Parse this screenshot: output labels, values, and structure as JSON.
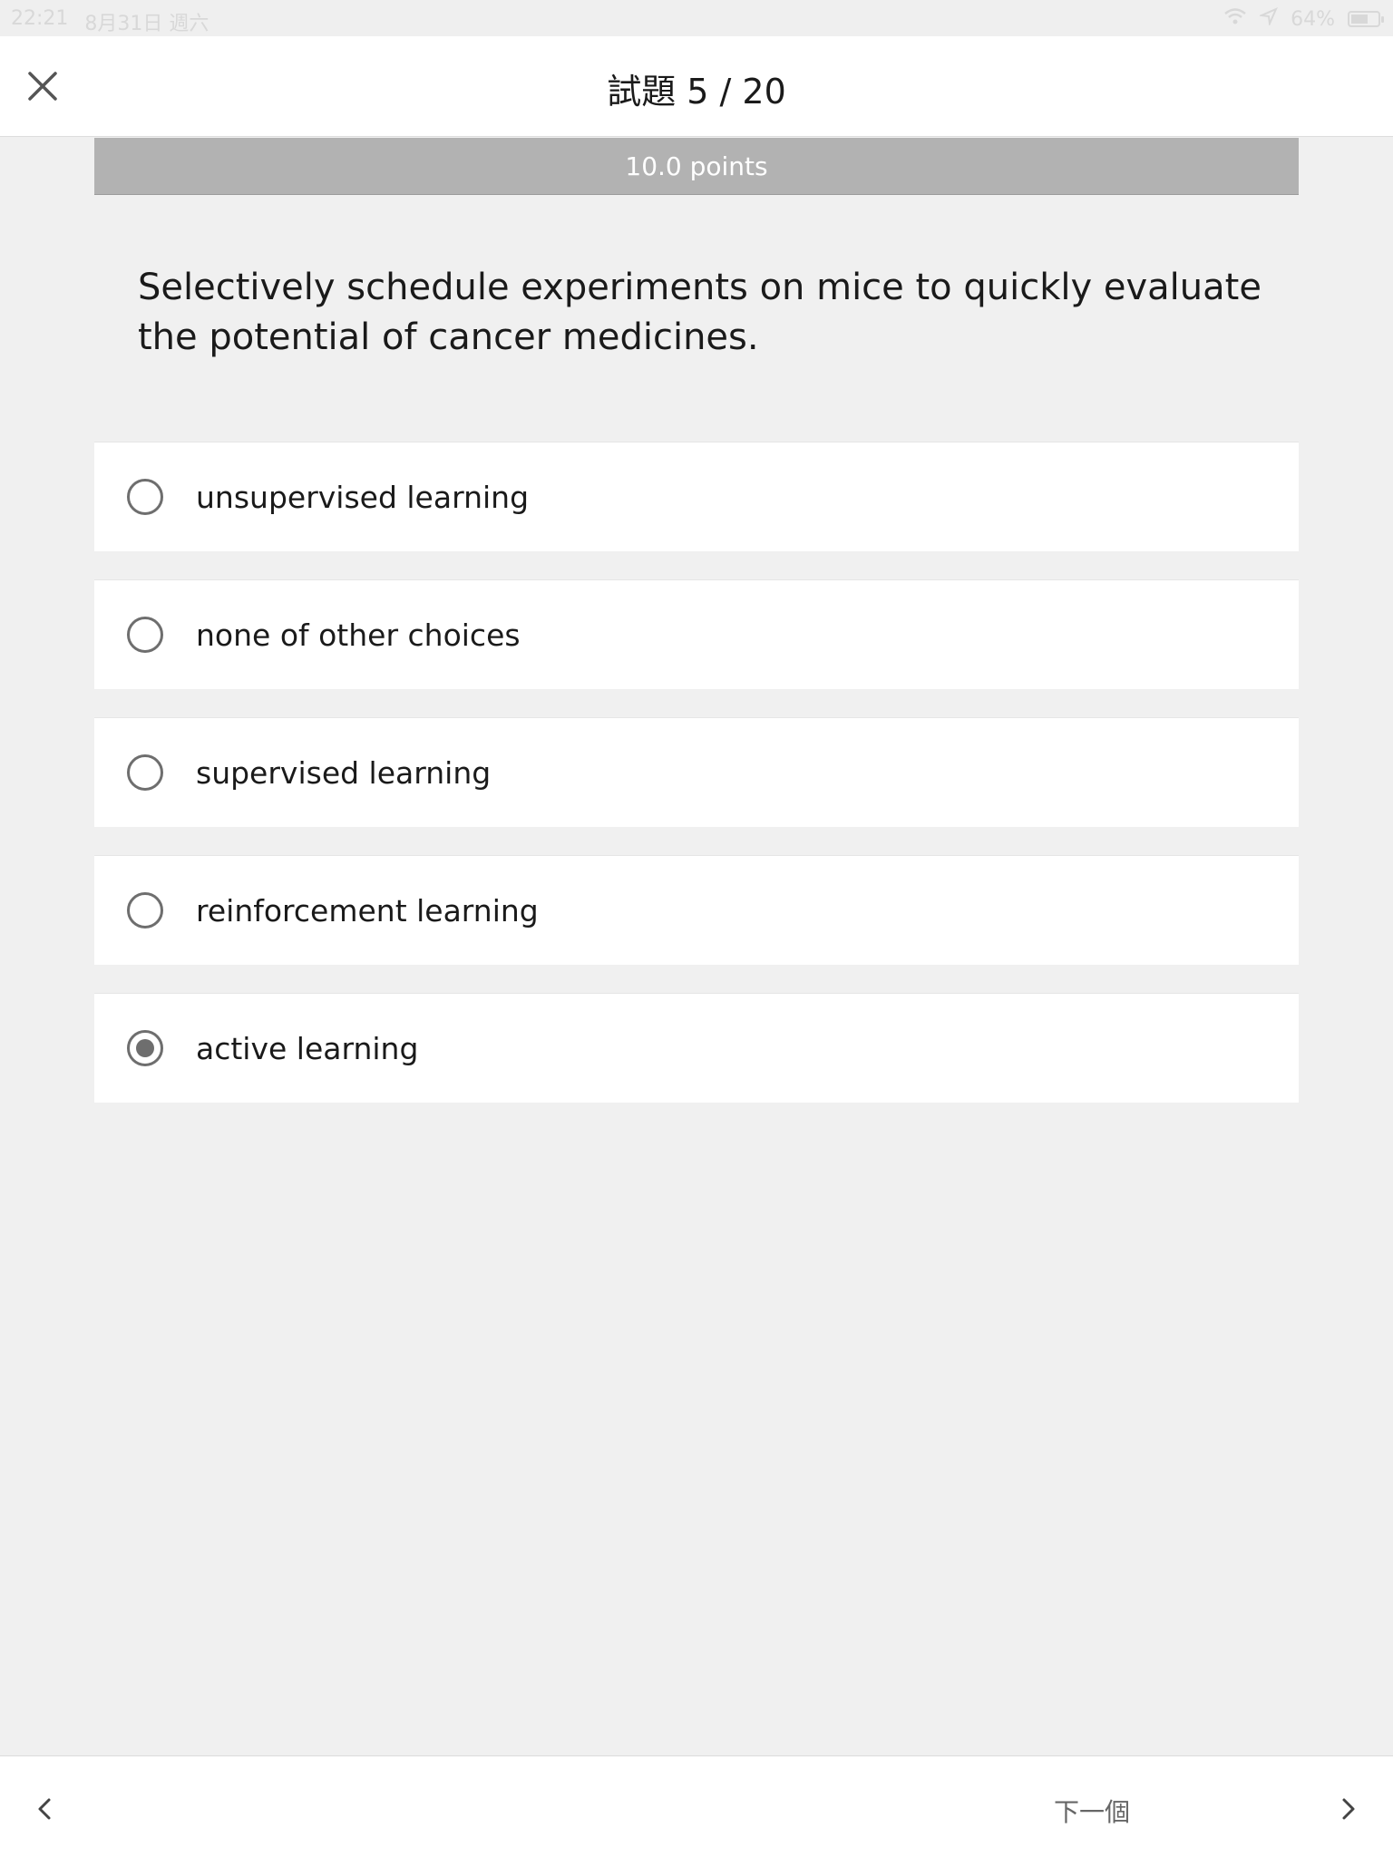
{
  "status_bar": {
    "time": "22:21",
    "date": "8月31日 週六",
    "battery_text": "64%",
    "battery_level": 0.64,
    "icons": [
      "wifi-icon",
      "location-arrow-icon",
      "battery-icon"
    ]
  },
  "header": {
    "title": "試題 5 / 20",
    "close_icon": "close-icon"
  },
  "points": "10.0 points",
  "question": {
    "text": "Selectively schedule experiments on mice to quickly evaluate the potential of cancer medicines."
  },
  "options": [
    {
      "label": "unsupervised learning",
      "selected": false
    },
    {
      "label": "none of other choices",
      "selected": false
    },
    {
      "label": "supervised learning",
      "selected": false
    },
    {
      "label": "reinforcement learning",
      "selected": false
    },
    {
      "label": "active learning",
      "selected": true
    }
  ],
  "footer": {
    "next_label": "下一個",
    "prev_icon": "chevron-left-icon",
    "next_icon": "chevron-right-icon"
  },
  "colors": {
    "background": "#f0f0f0",
    "points_bar": "#b2b2b2",
    "radio": "#6e6e6e"
  }
}
